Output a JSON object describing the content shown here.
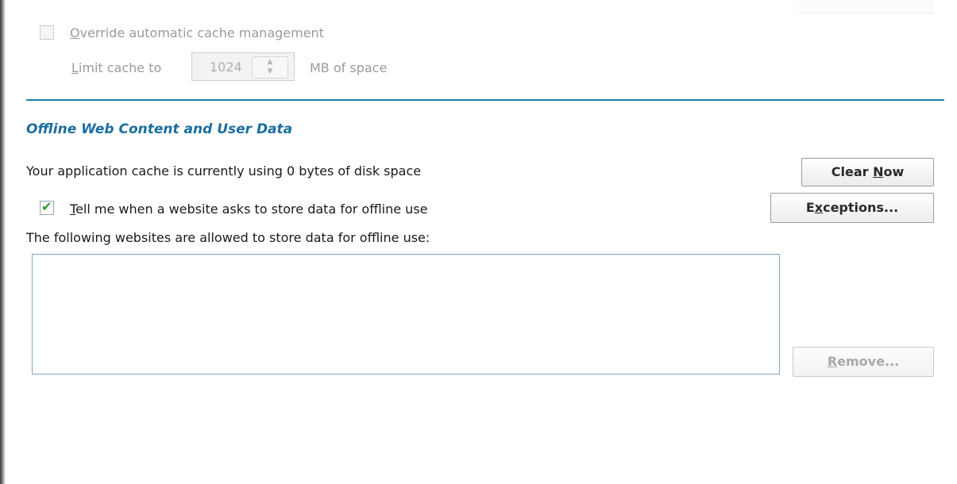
{
  "cache": {
    "override_label": "Override automatic cache management",
    "limit_label": "Limit cache to",
    "limit_value": "1024",
    "unit_label": "MB of space",
    "override_checked": false
  },
  "offline": {
    "title": "Offline Web Content and User Data",
    "usage_text": "Your application cache is currently using 0 bytes of disk space",
    "clear_now_label": "Clear Now",
    "tell_me_label": "Tell me when a website asks to store data for offline use",
    "tell_me_checked": true,
    "exceptions_label": "Exceptions...",
    "allowed_label": "The following websites are allowed to store data for offline use:",
    "allowed_sites": [],
    "remove_label": "Remove..."
  },
  "colors": {
    "accent": "#1d7fa9",
    "section_title": "#1b6e9f",
    "check_mark": "#2f9a2f"
  },
  "icons": {
    "checkbox_checked": "check-mark-icon",
    "spinner": "up-down-arrows-icon"
  }
}
